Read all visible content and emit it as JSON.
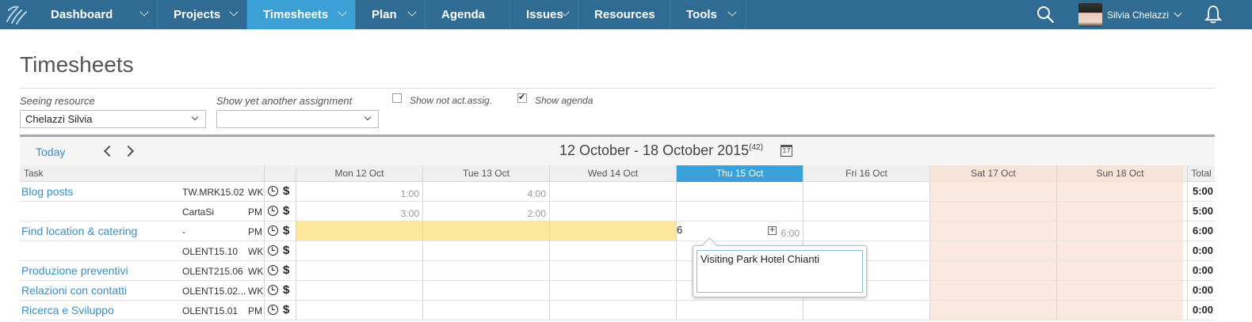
{
  "nav": {
    "items": [
      {
        "label": "Dashboard",
        "chevron": true
      },
      {
        "label": "Projects",
        "chevron": true
      },
      {
        "label": "Timesheets",
        "chevron": true,
        "active": true
      },
      {
        "label": "Plan",
        "chevron": true
      },
      {
        "label": "Agenda",
        "chevron": false
      },
      {
        "label": "Issues",
        "chevron": true
      },
      {
        "label": "Resources",
        "chevron": false
      },
      {
        "label": "Tools",
        "chevron": true
      }
    ],
    "user_name": "Silvia Chelazzi",
    "accent": "#2f6b93",
    "active_color": "#3aa0d6"
  },
  "page": {
    "title": "Timesheets"
  },
  "filters": {
    "resource_label": "Seeing resource",
    "resource_value": "Chelazzi Silvia",
    "assignment_label": "Show yet another assignment",
    "assignment_value": "",
    "not_active_label": "Show not act.assig.",
    "not_active_checked": false,
    "agenda_label": "Show agenda",
    "agenda_checked": true
  },
  "toolbar": {
    "today_label": "Today",
    "range_label": "12 October - 18 October 2015",
    "week_number": "(42)",
    "calendar_glyph": "17"
  },
  "grid": {
    "task_header": "Task",
    "total_header": "Total",
    "days": [
      {
        "label": "Mon 12 Oct",
        "type": "normal"
      },
      {
        "label": "Tue 13 Oct",
        "type": "normal"
      },
      {
        "label": "Wed 14 Oct",
        "type": "normal"
      },
      {
        "label": "Thu 15 Oct",
        "type": "today"
      },
      {
        "label": "Fri 16 Oct",
        "type": "normal"
      },
      {
        "label": "Sat 17 Oct",
        "type": "weekend"
      },
      {
        "label": "Sun 18 Oct",
        "type": "weekend"
      }
    ],
    "rows": [
      {
        "name": "Blog posts",
        "code": "TW.MRK15.02",
        "role": "WK",
        "cells": [
          "1:00",
          "4:00",
          "",
          "",
          "",
          "",
          ""
        ],
        "total": "5:00"
      },
      {
        "name": "",
        "code": "CartaSi",
        "role": "PM",
        "cells": [
          "3:00",
          "2:00",
          "",
          "",
          "",
          "",
          ""
        ],
        "total": "5:00"
      },
      {
        "name": "Find location & catering",
        "code": "-",
        "role": "PM",
        "cells": [
          "",
          "",
          "",
          "6:00",
          "",
          "",
          ""
        ],
        "total": "6:00",
        "entry": "6",
        "highlight_days": [
          0,
          1,
          2
        ]
      },
      {
        "name": "",
        "code": "OLENT15.10",
        "role": "WK",
        "cells": [
          "",
          "",
          "",
          "",
          "",
          "",
          ""
        ],
        "total": "0:00"
      },
      {
        "name": "Produzione preventivi",
        "code": "OLENT215.06",
        "role": "WK",
        "cells": [
          "",
          "",
          "",
          "",
          "",
          "",
          ""
        ],
        "total": "0:00"
      },
      {
        "name": "Relazioni con contatti",
        "code": "OLENT15.02...",
        "role": "WK",
        "cells": [
          "",
          "",
          "",
          "",
          "",
          "",
          ""
        ],
        "total": "0:00"
      },
      {
        "name": "Ricerca e Sviluppo",
        "code": "OLENT15.01",
        "role": "PM",
        "cells": [
          "",
          "",
          "",
          "",
          "",
          "",
          ""
        ],
        "total": "0:00"
      }
    ]
  },
  "popup": {
    "text": "Visiting Park Hotel Chianti"
  }
}
